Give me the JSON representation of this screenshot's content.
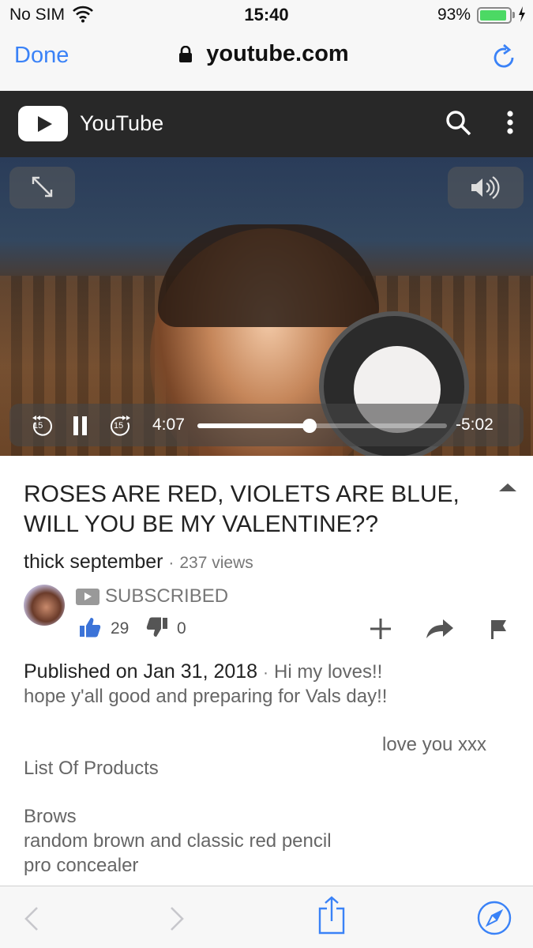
{
  "status_bar": {
    "carrier": "No SIM",
    "time": "15:40",
    "battery_percent": "93%",
    "battery_level": 0.93
  },
  "browser": {
    "done_label": "Done",
    "url": "youtube.com"
  },
  "youtube": {
    "brand": "YouTube"
  },
  "player": {
    "current_time": "4:07",
    "remaining_time": "-5:02",
    "progress": 0.45,
    "skip_back": "15",
    "skip_forward": "15"
  },
  "video": {
    "title_line1": "ROSES ARE RED, VIOLETS ARE BLUE,",
    "title_line2": "WILL YOU BE MY VALENTINE??",
    "channel": "thick september",
    "separator": "·",
    "views": "237 views",
    "subscribe_label": "SUBSCRIBED",
    "likes": "29",
    "dislikes": "0"
  },
  "description": {
    "published": "Published on Jan 31, 2018",
    "separator": "·",
    "line1": "Hi my loves!!",
    "line2": "hope y'all good and preparing for Vals day!!",
    "line3": "love you xxx",
    "line4": "List Of Products",
    "line5": "Brows",
    "line6": "random brown and classic red pencil",
    "line7": "pro concealer"
  },
  "colors": {
    "accent": "#3a82f7",
    "youtube_bar": "#282828",
    "battery": "#4cd964"
  }
}
